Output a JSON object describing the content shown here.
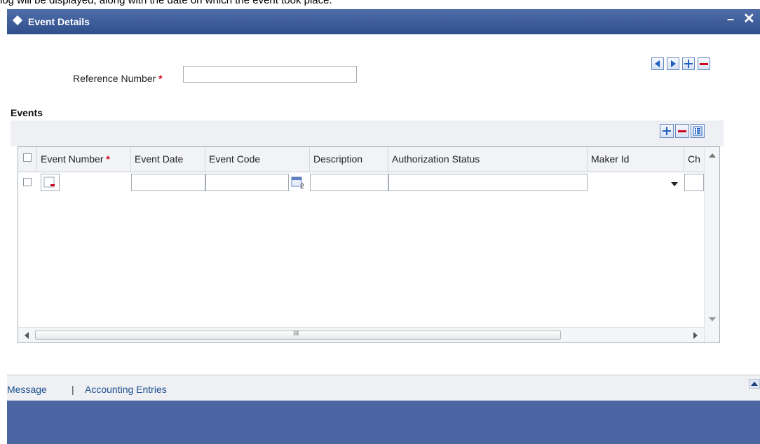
{
  "doc_text": "log will be displayed, along with the date on which the event took place.",
  "window": {
    "title": "Event Details",
    "minimize_glyph": "–",
    "close_glyph": "✕"
  },
  "nav_buttons": [
    "previous-icon",
    "next-icon",
    "add-icon",
    "remove-icon"
  ],
  "reference": {
    "label": "Reference Number",
    "required_mark": "*",
    "value": ""
  },
  "events": {
    "heading": "Events",
    "toolbar": [
      "add-row-icon",
      "delete-row-icon",
      "single-view-icon"
    ],
    "columns": [
      {
        "label": "Event Number",
        "required": "*"
      },
      {
        "label": "Event Date"
      },
      {
        "label": "Event Code"
      },
      {
        "label": "Description"
      },
      {
        "label": "Authorization Status"
      },
      {
        "label": "Maker Id"
      },
      {
        "label": "Ch"
      }
    ],
    "row": {
      "event_number": "",
      "event_date": "",
      "event_code": "",
      "description": "",
      "authorization_status": "",
      "maker_id": ""
    },
    "scroll_thumb_glyph": "III"
  },
  "footer": {
    "message": "Message",
    "separator": "|",
    "accounting_entries": "Accounting Entries"
  },
  "colors": {
    "title_bar": "#3a5a98",
    "bottom_bar": "#4a65a2",
    "required": "#d0021b",
    "link": "#1d4f91"
  }
}
